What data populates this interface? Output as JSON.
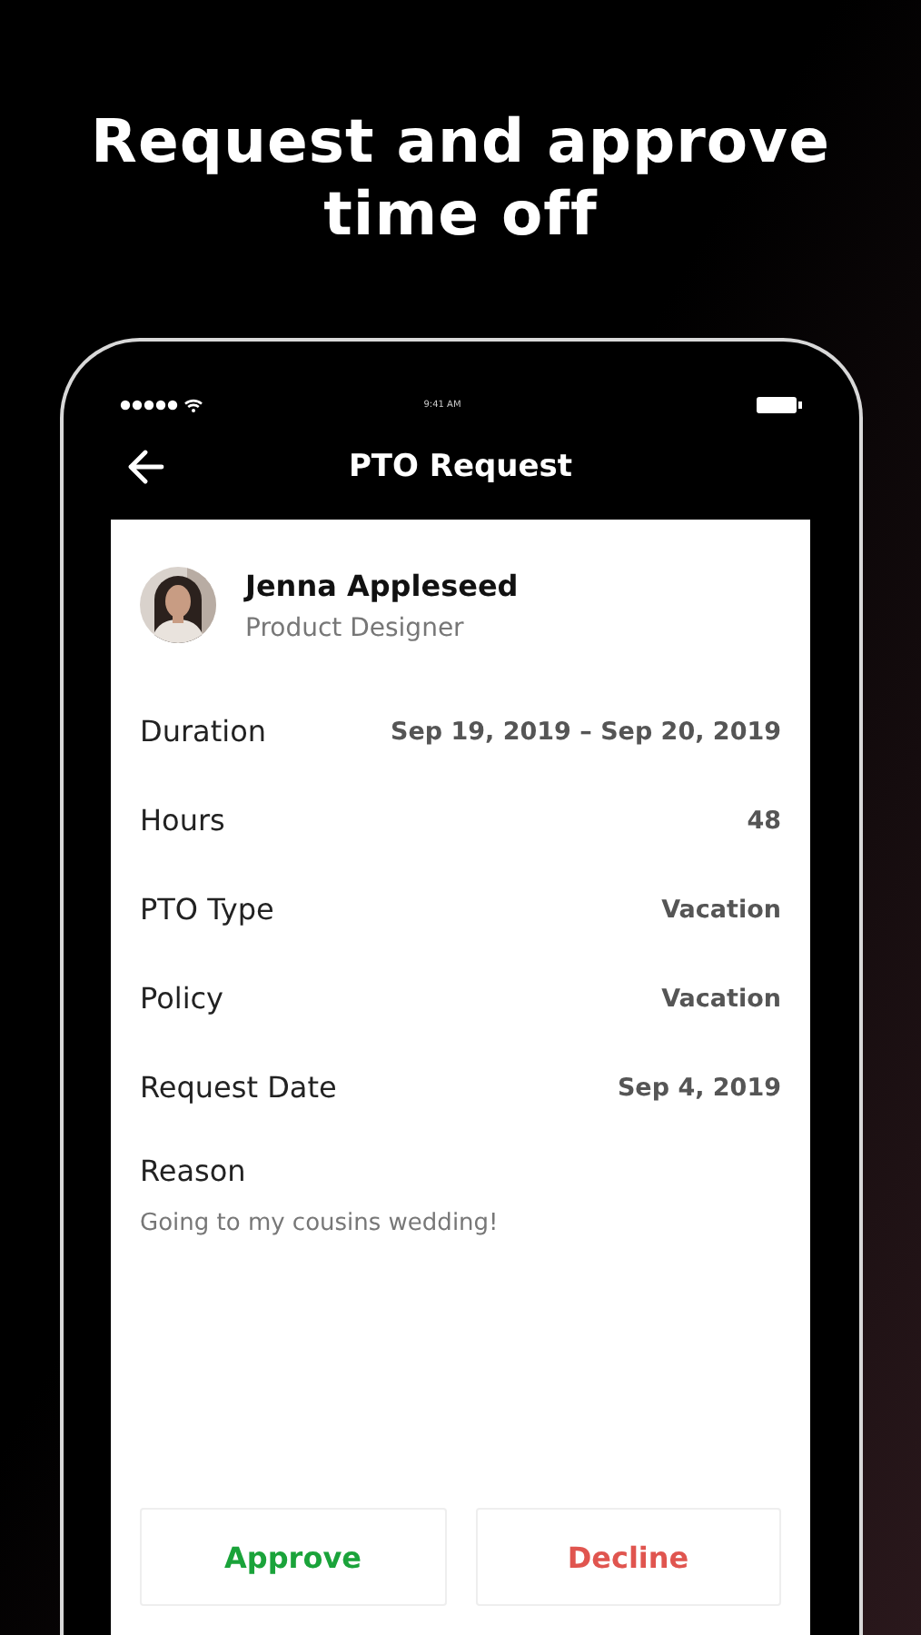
{
  "headline": "Request and approve time off",
  "status_bar": {
    "time": "9:41 AM"
  },
  "nav": {
    "title": "PTO Request"
  },
  "employee": {
    "name": "Jenna Appleseed",
    "role": "Product Designer"
  },
  "details": [
    {
      "label": "Duration",
      "value": "Sep 19, 2019 – Sep 20, 2019"
    },
    {
      "label": "Hours",
      "value": "48"
    },
    {
      "label": "PTO Type",
      "value": "Vacation"
    },
    {
      "label": "Policy",
      "value": "Vacation"
    },
    {
      "label": "Request Date",
      "value": "Sep 4, 2019"
    }
  ],
  "reason": {
    "label": "Reason",
    "text": "Going to my cousins wedding!"
  },
  "buttons": [
    {
      "label": "Approve",
      "kind": "approve"
    },
    {
      "label": "Decline",
      "kind": "decline"
    }
  ]
}
